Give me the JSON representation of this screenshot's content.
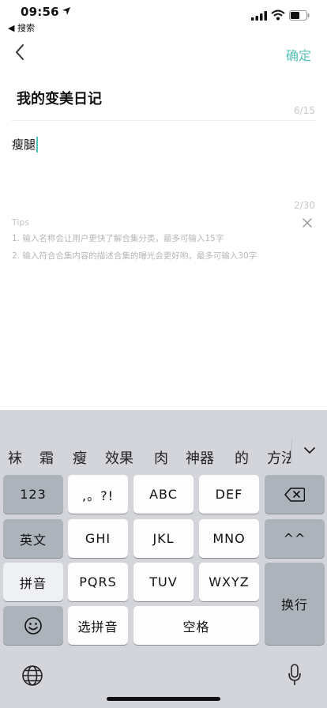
{
  "status_bar": {
    "time": "09:56",
    "back_app": "◀ 搜索"
  },
  "nav": {
    "confirm_label": "确定"
  },
  "form": {
    "title_value": "我的变美日记",
    "title_count": "6/15",
    "desc_value": "瘦腿",
    "desc_count": "2/30"
  },
  "tips": {
    "heading": "Tips",
    "items": [
      "1. 输入名称会让用户更快了解合集分类，最多可输入15字",
      "2. 输入符合合集内容的描述合集的曝光会更好哟，最多可输入30字"
    ]
  },
  "keyboard": {
    "candidates": [
      "袜",
      "霜",
      "瘦",
      "效果",
      "肉",
      "神器",
      "的",
      "方法"
    ],
    "rows": {
      "row1": [
        "123",
        ",。?!",
        "ABC",
        "DEF"
      ],
      "row2": [
        "英文",
        "GHI",
        "JKL",
        "MNO",
        "^^"
      ],
      "row3": [
        "拼音",
        "PQRS",
        "TUV",
        "WXYZ",
        "换行"
      ],
      "row4": [
        "选拼音",
        "空格"
      ]
    }
  },
  "colors": {
    "accent": "#59c1b7",
    "cursor": "#4ec3b5",
    "keyboard_bg": "#d3d5db"
  },
  "icons": [
    "location-arrow-icon",
    "signal-icon",
    "wifi-icon",
    "battery-icon",
    "back-chevron-icon",
    "close-icon",
    "chevron-down-icon",
    "backspace-icon",
    "emoji-icon",
    "globe-icon",
    "microphone-icon"
  ]
}
